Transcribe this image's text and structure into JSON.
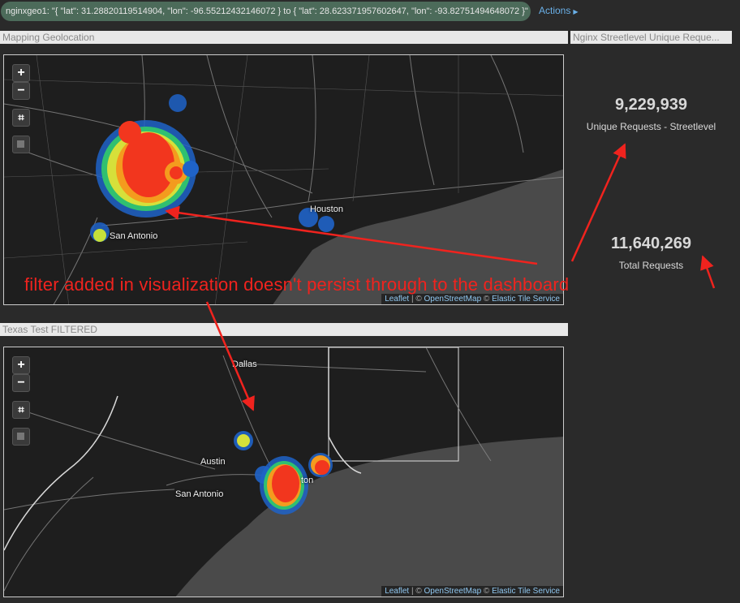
{
  "filter_bar": {
    "filter_text": "nginxgeo1: \"{ \"lat\": 31.28820119514904, \"lon\": -96.55212432146072 } to { \"lat\": 28.623371957602647, \"lon\": -93.82751494648072 }\"",
    "actions_label": "Actions"
  },
  "panels": {
    "mapping": {
      "title": "Mapping Geolocation"
    },
    "filtered": {
      "title": "Texas Test FILTERED"
    },
    "metric": {
      "title": "Nginx Streetlevel Unique Reque..."
    }
  },
  "map_controls": {
    "zoom_in": "+",
    "zoom_out": "−",
    "crop": "⌗"
  },
  "attribution": {
    "leaflet": "Leaflet",
    "separator": " | © ",
    "osm": "OpenStreetMap",
    "sep2": " © ",
    "elastic": "Elastic Tile Service"
  },
  "map1_cities": {
    "houston": "Houston",
    "san_antonio": "San Antonio"
  },
  "map2_cities": {
    "dallas": "Dallas",
    "austin": "Austin",
    "san_antonio": "San Antonio",
    "houston_partial": "ton"
  },
  "metrics": {
    "unique_value": "9,229,939",
    "unique_label": "Unique Requests - Streetlevel",
    "total_value": "11,640,269",
    "total_label": "Total Requests"
  },
  "annotation": "filter added in visualization doesn't persist through to the dashboard",
  "colors": {
    "annotation": "#f0231e",
    "filter_pill": "#4c6b5a",
    "link": "#6ab0e8"
  }
}
